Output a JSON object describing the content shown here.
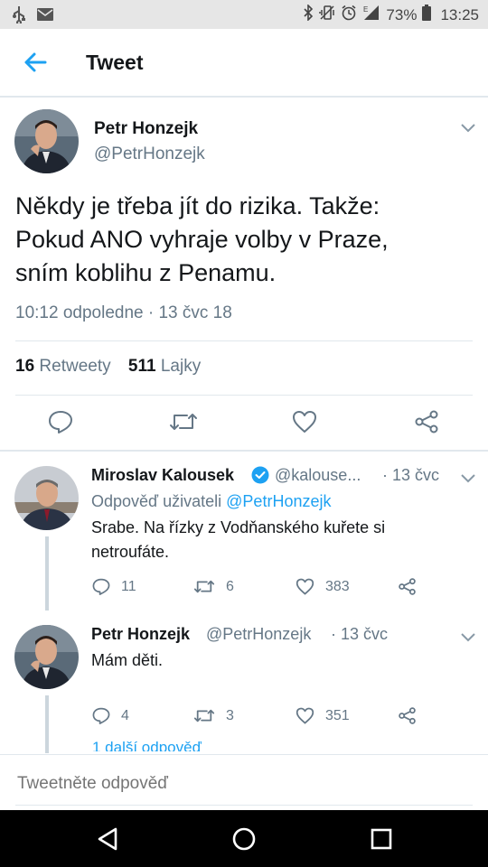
{
  "status_bar": {
    "battery": "73%",
    "time": "13:25",
    "icons": [
      "usb-icon",
      "mail-icon",
      "bluetooth-icon",
      "vibrate-icon",
      "alarm-icon",
      "signal-icon",
      "battery-icon"
    ]
  },
  "app_bar": {
    "title": "Tweet",
    "back_icon": "back-arrow-icon"
  },
  "main_tweet": {
    "author_name": "Petr Honzejk",
    "author_handle": "@PetrHonzejk",
    "text_lines": [
      "Někdy je třeba jít do rizika. Takže:",
      "Pokud ANO vyhraje volby v Praze,",
      "sním koblihu z Penamu."
    ],
    "timestamp": "10:12 odpoledne · 13 čvc 18",
    "retweet_count": "16",
    "retweet_label": "Retweety",
    "like_count": "511",
    "like_label": "Lajky"
  },
  "replies": [
    {
      "author_name": "Miroslav Kalousek",
      "author_handle": "@kalouse...",
      "date": "· 13 čvc",
      "reply_to_prefix": "Odpověď uživateli",
      "reply_to_handle": "@PetrHonzejk",
      "text_lines": [
        "Srabe. Na řízky z Vodňanského kuřete si",
        "netroufáte."
      ],
      "reply_count": "11",
      "retweet_count": "6",
      "like_count": "383"
    },
    {
      "author_name": "Petr Honzejk",
      "author_handle": "@PetrHonzejk",
      "date": "· 13 čvc",
      "text_lines": [
        "Mám děti."
      ],
      "reply_count": "4",
      "retweet_count": "3",
      "like_count": "351"
    }
  ],
  "more_replies": "1 další odpověď",
  "compose": {
    "placeholder": "Tweetněte odpověď"
  },
  "colors": {
    "accent": "#1da1f2",
    "text": "#14171a",
    "muted": "#657786",
    "divider": "#e1e8ed",
    "verified": "#1da1f2",
    "status_bar": "#e6e6e6",
    "nav_bar": "#000000"
  }
}
